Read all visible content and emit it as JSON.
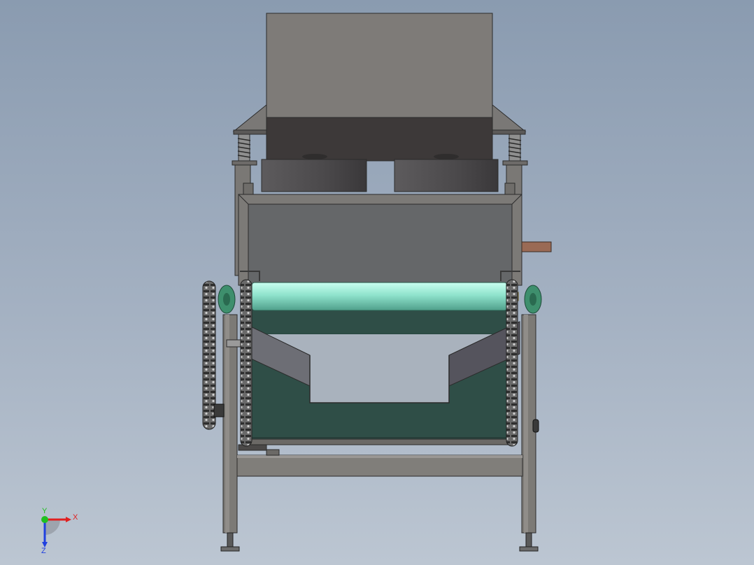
{
  "viewport": {
    "background_top": "#8a9bb0",
    "background_bottom": "#bcc6d2"
  },
  "model": {
    "parts": [
      "hopper",
      "vibrator-springs",
      "vibrator-motors",
      "feed-box",
      "top-roller",
      "conveyor-belt",
      "guide-plates",
      "chain-drive",
      "frame",
      "leveling-feet"
    ],
    "colors": {
      "frame": "#7c7a76",
      "hopper": "#7e7b78",
      "hopper_dark": "#3d3939",
      "belt": "#2f4e47",
      "roller": "#8fe3cc",
      "chain": "#4a4a4a",
      "bearing": "#3e8f6d",
      "handle": "#9a6a55"
    }
  },
  "triad": {
    "x_label": "X",
    "y_label": "Y",
    "z_label": "Z",
    "x_color": "#e02020",
    "y_color": "#20c020",
    "z_color": "#2040e0"
  }
}
